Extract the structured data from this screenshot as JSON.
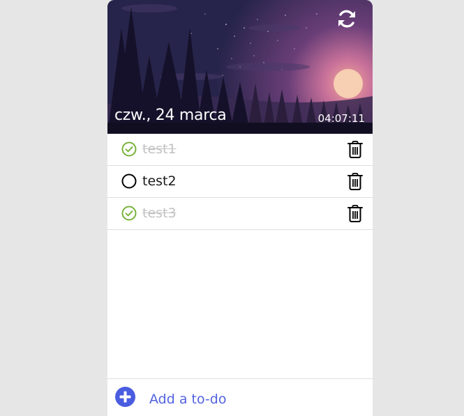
{
  "header": {
    "date": "czw., 24 marca",
    "time": "04:07:11",
    "refresh_icon": "refresh-icon"
  },
  "todos": [
    {
      "text": "test1",
      "done": true
    },
    {
      "text": "test2",
      "done": false
    },
    {
      "text": "test3",
      "done": true
    }
  ],
  "footer": {
    "add_label": "Add a to-do",
    "add_icon": "plus-circle-icon"
  },
  "colors": {
    "check_done": "#7ab23c",
    "accent": "#4a5ce0",
    "done_text": "#c2c2c2",
    "sun": "#f7cfb2",
    "sky_top": "#2a2848"
  }
}
